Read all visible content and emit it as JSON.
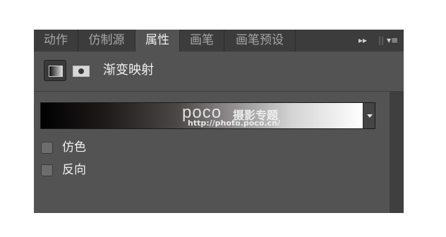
{
  "tabs": [
    {
      "label": "动作",
      "active": false
    },
    {
      "label": "仿制源",
      "active": false
    },
    {
      "label": "属性",
      "active": true
    },
    {
      "label": "画笔",
      "active": false
    },
    {
      "label": "画笔预设",
      "active": false
    }
  ],
  "tab_controls": {
    "expand": "▸▸",
    "menu": "▾≡"
  },
  "adjustment": {
    "title": "渐变映射"
  },
  "gradient": {
    "stops": [
      "#000000",
      "#ffffff"
    ],
    "watermark_logo": "poco",
    "watermark_text": "摄影专题",
    "watermark_url": "http://photo.poco.cn/"
  },
  "options": [
    {
      "label": "仿色",
      "checked": false
    },
    {
      "label": "反向",
      "checked": false
    }
  ],
  "colors": {
    "panel_bg": "#535353",
    "tabbar_bg": "#3c3c3c",
    "text": "#f0f0f0"
  }
}
